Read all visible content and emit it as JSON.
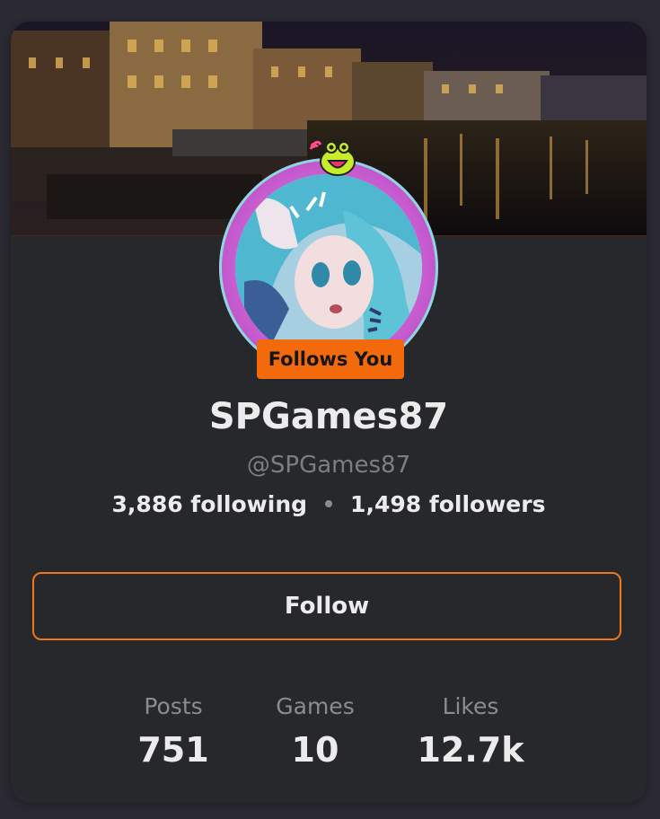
{
  "profile": {
    "follows_you_badge": "Follows You",
    "display_name": "SPGames87",
    "handle": "@SPGames87",
    "following_text": "3,886 following",
    "followers_text": "1,498 followers"
  },
  "actions": {
    "follow_label": "Follow"
  },
  "stats": [
    {
      "label": "Posts",
      "value": "751"
    },
    {
      "label": "Games",
      "value": "10"
    },
    {
      "label": "Likes",
      "value": "12.7k"
    }
  ],
  "colors": {
    "page_background": "#2b2a33",
    "card_background": "#26282b",
    "accent_orange": "#f26a0c",
    "avatar_ring": "#c95ed2",
    "primary_text": "#ececec",
    "muted_text": "#7d7e82"
  },
  "icons": {
    "banner": "night-canal-city-banner-image",
    "avatar": "anime-character-avatar-image",
    "avatar_decoration": "frog-face-icon"
  }
}
